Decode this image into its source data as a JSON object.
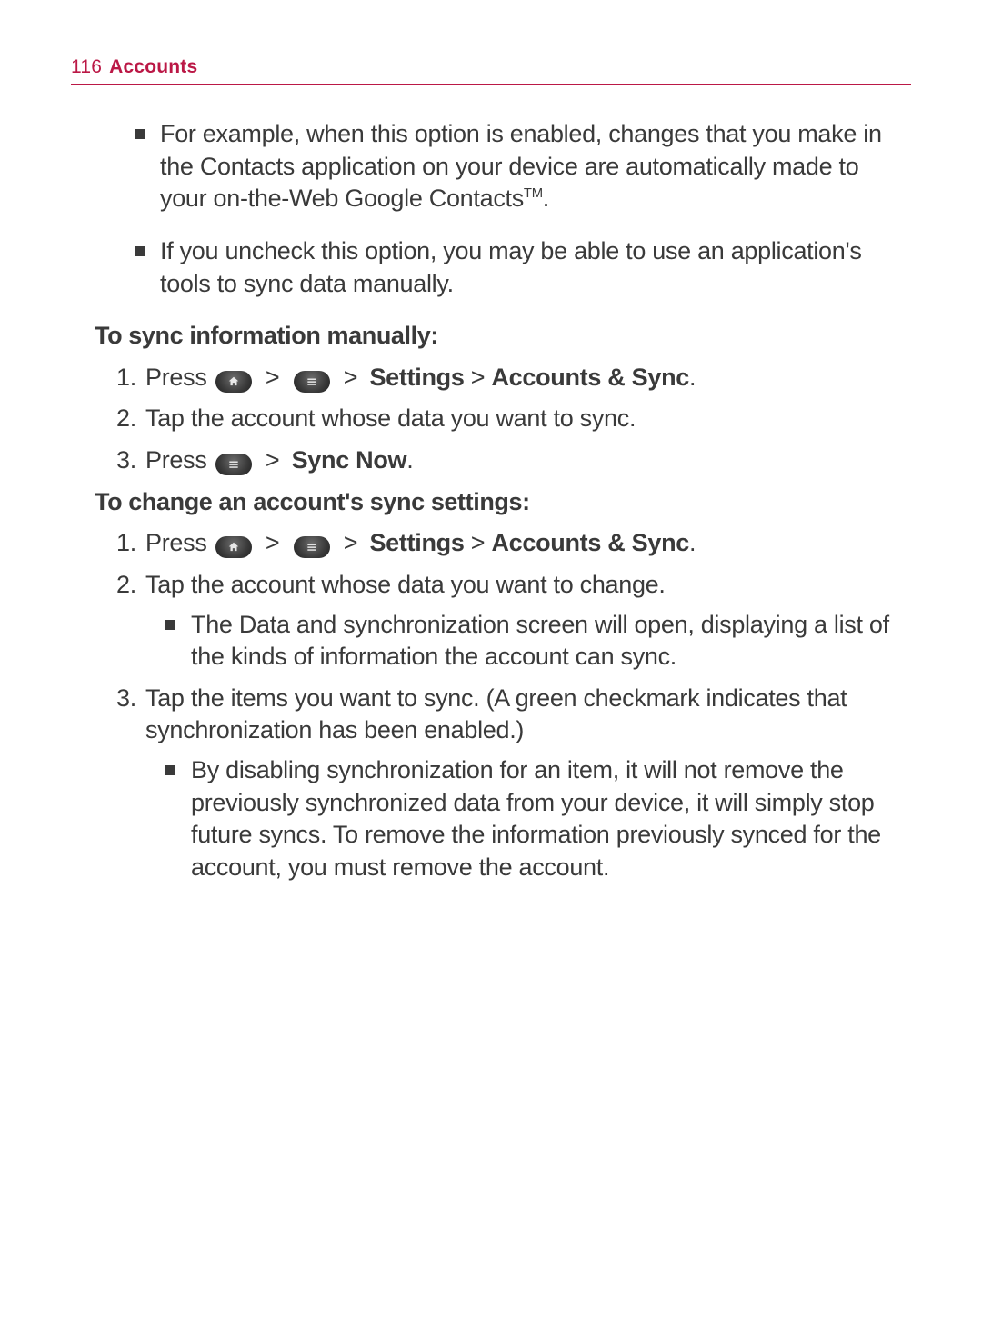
{
  "header": {
    "page_number": "116",
    "section": "Accounts"
  },
  "intro_bullets": [
    {
      "pre": "For example, when this option is enabled, changes that you make in the Contacts application on your device are automatically made to your on-the-Web Google Contacts",
      "tm": "TM",
      "post": "."
    },
    {
      "pre": "If you uncheck this option, you may be able to use an application's tools to sync data manually."
    }
  ],
  "section1": {
    "heading": "To sync information manually:",
    "steps": [
      {
        "num": "1.",
        "lead": "Press ",
        "icon1": "home",
        "sep1": " > ",
        "icon2": "menu",
        "sep2": " > ",
        "bold1": "Settings",
        "mid": " > ",
        "bold2": "Accounts & Sync",
        "tail": "."
      },
      {
        "num": "2.",
        "plain": "Tap the account whose data you want to sync."
      },
      {
        "num": "3.",
        "lead": "Press ",
        "icon1": "menu",
        "sep1": " > ",
        "bold1": "Sync Now",
        "tail": "."
      }
    ]
  },
  "section2": {
    "heading": "To change an account's sync settings:",
    "steps": [
      {
        "num": "1.",
        "lead": "Press ",
        "icon1": "home",
        "sep1": " > ",
        "icon2": "menu",
        "sep2": " > ",
        "bold1": "Settings",
        "mid": " > ",
        "bold2": "Accounts & Sync",
        "tail": "."
      },
      {
        "num": "2.",
        "plain": "Tap the account whose data you want to change.",
        "sub": [
          "The Data and synchronization screen will open, displaying a list of the kinds of information the account can sync."
        ]
      },
      {
        "num": "3.",
        "plain": "Tap the items you want to sync. (A green checkmark indicates that synchronization has been enabled.)",
        "sub": [
          "By disabling synchronization for an item, it will not remove the previously synchronized data from your device, it will simply stop future syncs. To remove the information previously synced for the account, you must remove the account."
        ]
      }
    ]
  }
}
